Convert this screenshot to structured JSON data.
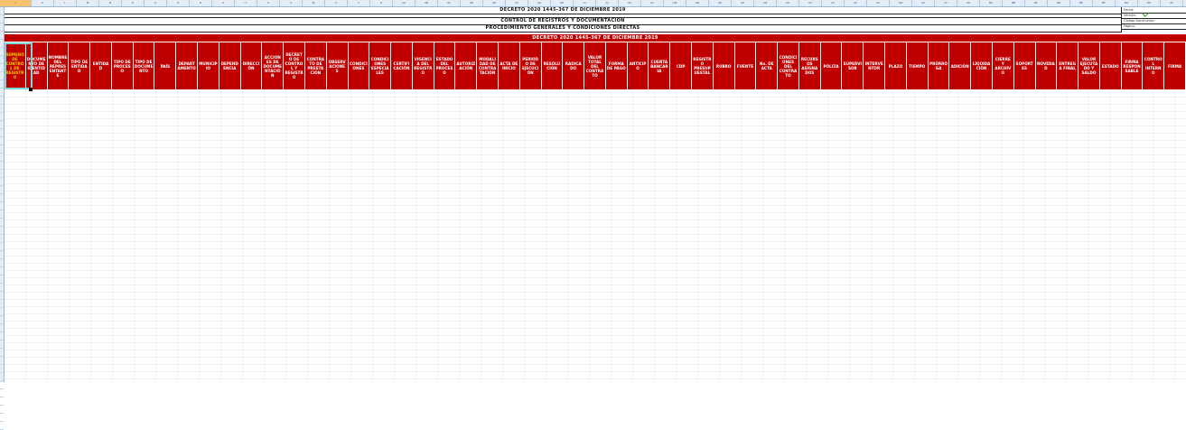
{
  "sheet": {
    "column_letters": [
      "I",
      "K",
      "L",
      "M",
      "N",
      "O",
      "P",
      "Q",
      "R",
      "S",
      "T",
      "U",
      "V",
      "W",
      "X",
      "Y",
      "Z",
      "AA",
      "AB",
      "AC",
      "AD",
      "AE",
      "AF",
      "AG",
      "AH",
      "AI",
      "AJ",
      "AK",
      "AL",
      "AM",
      "AN",
      "AO",
      "AP",
      "AQ",
      "AR",
      "AS",
      "AT",
      "AU",
      "AV",
      "AW",
      "AX",
      "AY",
      "AZ",
      "BA",
      "BB",
      "BC",
      "BD",
      "BE",
      "BF",
      "BG",
      "BH",
      "BI",
      "BJ",
      "BK",
      "BL",
      "BM",
      "BN"
    ],
    "selected_column": "I"
  },
  "titles": {
    "line1": "DECRETO 2020 1445-367 DE DICIEMBRE 2019",
    "line2": "CONTROL DE REGISTROS Y DOCUMENTACIÓN",
    "line3": "PROCEDIMIENTO GENERALES Y CONDICIONES DIRECTAS"
  },
  "meta": {
    "row1_label": "Fecha:",
    "row1_value": "",
    "row2_label": "Versión:",
    "row2_value": "",
    "row3_label": "Código Documento:",
    "row3_value": "",
    "row4_label": "Página:",
    "row4_value": ""
  },
  "band": {
    "label": "DECRETO 2020 1445-367 DE DICIEMBRE 2019"
  },
  "headers": [
    "NÚMERO DE CONTROL DE REGISTRO",
    "DOCUMENTO DE IDENTIDAD",
    "NOMBRE DEL REPRESENTANTE",
    "TIPO DE ENTIDAD",
    "ENTIDAD",
    "TIPO DE PROCESO",
    "TIPO DE DOCUMENTO",
    "PAÍS",
    "DEPARTAMENTO",
    "MUNICIPIO",
    "DEPENDENCIA",
    "DIRECCIÓN",
    "ACCIONES DE DOCUMENTACIÓN",
    "DECRETO DE CONTROL Y REGISTRO",
    "CONTRATO DE PRESTACIÓN",
    "OBSERVACIONES",
    "CONDICIONES",
    "CONDICIONES ESPECIALES",
    "CERTIFICACIÓN",
    "VIGENCIA DEL REGISTRO",
    "ESTADO DEL PROCESO",
    "AUTORIZACIÓN",
    "MODALIDAD DE CONTRATACIÓN",
    "ACTA DE INICIO",
    "PERIODO DE EJECUCIÓN",
    "RESOLUCIÓN",
    "RADICADO",
    "VALOR TOTAL DEL CONTRATO",
    "FORMA DE PAGO",
    "ANTICIPO",
    "CUENTA BANCARIA",
    "CDP",
    "REGISTRO PRESUPUESTAL",
    "RUBRO",
    "FUENTE",
    "No. DE ACTA",
    "CONDICIONES DEL CONTRATO",
    "RECURSOS ASIGNADOS",
    "PÓLIZA",
    "SUPERVISOR",
    "INTERVENTOR",
    "PLAZO",
    "TIEMPO",
    "PRÓRROGA",
    "ADICIÓN",
    "LIQUIDACIÓN",
    "CIERRE Y ARCHIVO",
    "SOPORTES",
    "NOVEDAD",
    "ENTREGA FINAL",
    "VALOR EJECUTADO Y SALDO",
    "ESTADO",
    "FIRMA RESPONSABLE",
    "CONTROL INTERNO",
    "FIRMA"
  ]
}
